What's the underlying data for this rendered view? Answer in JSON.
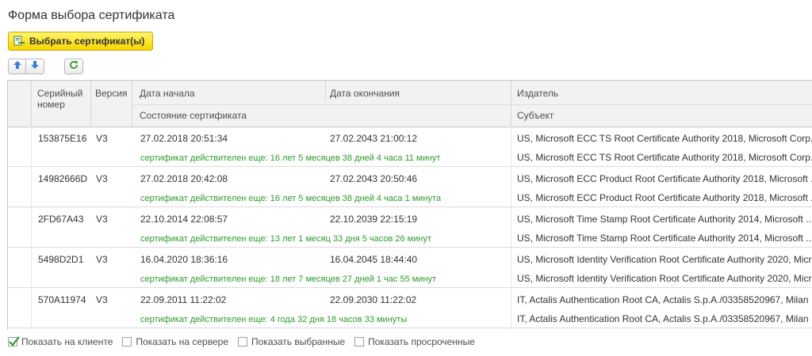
{
  "form": {
    "title": "Форма выбора сертификата",
    "select_button_label": "Выбрать сертификат(ы)"
  },
  "toolbar": {
    "move_up_icon": "arrow-up-icon",
    "move_down_icon": "arrow-down-icon",
    "refresh_icon": "refresh-icon"
  },
  "table": {
    "headers": {
      "serial_line1": "Серийный",
      "serial_line2": "номер",
      "version": "Версия",
      "start_date": "Дата начала",
      "end_date": "Дата окончания",
      "issuer": "Издатель",
      "status": "Состояние сертификата",
      "subject": "Субъект"
    },
    "rows": [
      {
        "serial": "153875E16",
        "version": "V3",
        "start": "27.02.2018 20:51:34",
        "end": "27.02.2043 21:00:12",
        "status": "сертификат действителен еще: 16 лет 5 месяцев 38 дней 4 часа 11 минут",
        "issuer": "US, Microsoft ECC TS Root Certificate Authority 2018, Microsoft Corp...",
        "subject": "US, Microsoft ECC TS Root Certificate Authority 2018, Microsoft Corp..."
      },
      {
        "serial": "14982666D",
        "version": "V3",
        "start": "27.02.2018 20:42:08",
        "end": "27.02.2043 20:50:46",
        "status": "сертификат действителен еще: 16 лет 5 месяцев 38 дней 4 часа 1 минута",
        "issuer": "US, Microsoft ECC Product Root Certificate Authority 2018, Microsoft ...",
        "subject": "US, Microsoft ECC Product Root Certificate Authority 2018, Microsoft ..."
      },
      {
        "serial": "2FD67A43",
        "version": "V3",
        "start": "22.10.2014 22:08:57",
        "end": "22.10.2039 22:15:19",
        "status": "сертификат действителен еще: 13 лет 1 месяц 33 дня 5 часов 26 минут",
        "issuer": "US, Microsoft Time Stamp Root Certificate Authority 2014, Microsoft ...",
        "subject": "US, Microsoft Time Stamp Root Certificate Authority 2014, Microsoft ..."
      },
      {
        "serial": "5498D2D1",
        "version": "V3",
        "start": "16.04.2020 18:36:16",
        "end": "16.04.2045 18:44:40",
        "status": "сертификат действителен еще: 18 лет 7 месяцев 27 дней 1 час 55 минут",
        "issuer": "US, Microsoft Identity Verification Root Certificate Authority 2020, Micr...",
        "subject": "US, Microsoft Identity Verification Root Certificate Authority 2020, Micr..."
      },
      {
        "serial": "570A11974",
        "version": "V3",
        "start": "22.09.2011 11:22:02",
        "end": "22.09.2030 11:22:02",
        "status": "сертификат действителен еще: 4 года 32 дня 18 часов 33 минуты",
        "issuer": "IT, Actalis Authentication Root CA, Actalis S.p.A./03358520967, Milan",
        "subject": "IT, Actalis Authentication Root CA, Actalis S.p.A./03358520967, Milan"
      }
    ]
  },
  "footer": {
    "options": [
      {
        "label": "Показать на клиенте",
        "checked": true
      },
      {
        "label": "Показать на сервере",
        "checked": false
      },
      {
        "label": "Показать выбранные",
        "checked": false
      },
      {
        "label": "Показать просроченные",
        "checked": false
      }
    ]
  },
  "colors": {
    "accent_button": "#f7d600",
    "status_text": "#2e9a2e",
    "icon_blue": "#3a7fd5",
    "icon_green": "#2e9a2e"
  }
}
